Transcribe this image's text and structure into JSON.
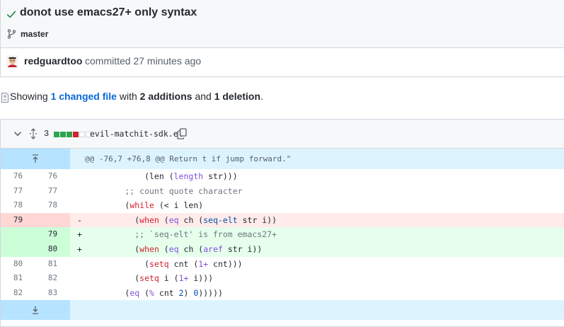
{
  "commit": {
    "title": "donot use emacs27+ only syntax",
    "branch": "master",
    "author": "redguardtoo",
    "meta": "committed 27 minutes ago"
  },
  "summary": {
    "prefix": "Showing",
    "changed_link": "1 changed file",
    "with": "with",
    "additions": "2 additions",
    "and": "and",
    "deletions": "1 deletion",
    "suffix": "."
  },
  "file": {
    "changes_count": "3",
    "diffstat": [
      "add",
      "add",
      "add",
      "del",
      "neutral",
      "neutral"
    ],
    "name": "evil-matchit-sdk.el"
  },
  "diff": {
    "hunk_header": "@@ -76,7 +76,8 @@ Return t if jump forward.\"",
    "lines": [
      {
        "type": "ctx",
        "old": "76",
        "new": "76",
        "sign": "",
        "code": [
          {
            "t": "            (len ("
          },
          {
            "t": "length",
            "c": "fn"
          },
          {
            "t": " str)))"
          }
        ]
      },
      {
        "type": "ctx",
        "old": "77",
        "new": "77",
        "sign": "",
        "code": [
          {
            "t": "        ;; count quote character",
            "c": "cm"
          }
        ]
      },
      {
        "type": "ctx",
        "old": "78",
        "new": "78",
        "sign": "",
        "code": [
          {
            "t": "        ("
          },
          {
            "t": "while",
            "c": "kw"
          },
          {
            "t": " (< i len)"
          }
        ]
      },
      {
        "type": "del",
        "old": "79",
        "new": "",
        "sign": "-",
        "code": [
          {
            "t": "          ("
          },
          {
            "t": "when",
            "c": "kw"
          },
          {
            "t": " ("
          },
          {
            "t": "eq",
            "c": "fn"
          },
          {
            "t": " ch ("
          },
          {
            "t": "seq-elt",
            "c": "fnb"
          },
          {
            "t": " str i))"
          }
        ]
      },
      {
        "type": "add",
        "old": "",
        "new": "79",
        "sign": "+",
        "code": [
          {
            "t": "          ;; `seq-elt' is from emacs27+",
            "c": "cm"
          }
        ]
      },
      {
        "type": "add",
        "old": "",
        "new": "80",
        "sign": "+",
        "code": [
          {
            "t": "          ("
          },
          {
            "t": "when",
            "c": "kw"
          },
          {
            "t": " ("
          },
          {
            "t": "eq",
            "c": "fn"
          },
          {
            "t": " ch ("
          },
          {
            "t": "aref",
            "c": "fn"
          },
          {
            "t": " str i))"
          }
        ]
      },
      {
        "type": "ctx",
        "old": "80",
        "new": "81",
        "sign": "",
        "code": [
          {
            "t": "            ("
          },
          {
            "t": "setq",
            "c": "kw"
          },
          {
            "t": " cnt ("
          },
          {
            "t": "1+",
            "c": "fn"
          },
          {
            "t": " cnt)))"
          }
        ]
      },
      {
        "type": "ctx",
        "old": "81",
        "new": "82",
        "sign": "",
        "code": [
          {
            "t": "          ("
          },
          {
            "t": "setq",
            "c": "kw"
          },
          {
            "t": " i ("
          },
          {
            "t": "1+",
            "c": "fn"
          },
          {
            "t": " i)))"
          }
        ]
      },
      {
        "type": "ctx",
        "old": "82",
        "new": "83",
        "sign": "",
        "code": [
          {
            "t": "        ("
          },
          {
            "t": "eq",
            "c": "fn"
          },
          {
            "t": " ("
          },
          {
            "t": "%",
            "c": "fn"
          },
          {
            "t": " cnt "
          },
          {
            "t": "2",
            "c": "fnb"
          },
          {
            "t": ") "
          },
          {
            "t": "0",
            "c": "fnb"
          },
          {
            "t": ")))))"
          }
        ]
      }
    ]
  },
  "colors": {
    "link": "#0969da",
    "add_square": "#2da44e",
    "del_square": "#cf222e",
    "neutral_square": "#d0d7de",
    "hunk_bg": "#ddf4ff",
    "del_bg": "#ffebe9",
    "add_bg": "#e6ffec"
  },
  "icons": [
    "check-icon",
    "branch-icon",
    "avatar",
    "file-diff-icon",
    "chevron-down-icon",
    "expand-all-icon",
    "copy-icon",
    "expand-up-icon",
    "expand-down-icon"
  ]
}
